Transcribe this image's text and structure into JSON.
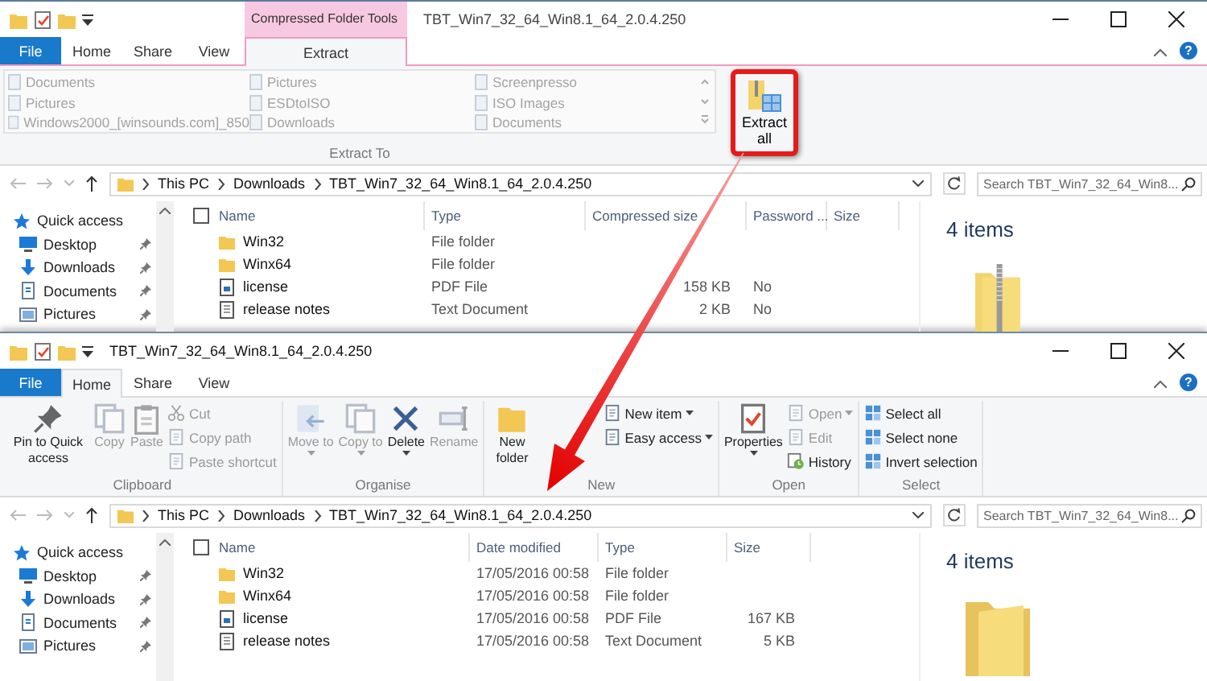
{
  "windows": [
    {
      "title": "TBT_Win7_32_64_Win8.1_64_2.0.4.250",
      "context_tab": "Compressed Folder Tools",
      "help": "?",
      "tabs": [
        {
          "label": "File",
          "kind": "file",
          "selected": false
        },
        {
          "label": "Home",
          "kind": "tab",
          "selected": false
        },
        {
          "label": "Share",
          "kind": "tab",
          "selected": false
        },
        {
          "label": "View",
          "kind": "tab",
          "selected": false
        },
        {
          "label": "Extract",
          "kind": "context",
          "selected": true
        }
      ],
      "ribbon": {
        "kind": "extract",
        "group_label": "Extract To",
        "button": "Extract all",
        "highlighted": true,
        "locations": [
          "Documents",
          "Pictures",
          "Screenpresso",
          "Pictures",
          "ESDtoISO",
          "ISO Images",
          "Windows2000_[winsounds.com]_850",
          "Downloads",
          "Documents"
        ]
      },
      "breadcrumb": [
        "This PC",
        "Downloads",
        "TBT_Win7_32_64_Win8.1_64_2.0.4.250"
      ],
      "search_placeholder": "Search TBT_Win7_32_64_Win8...",
      "nav": [
        {
          "label": "Quick access",
          "kind": "header",
          "pinned": false
        },
        {
          "label": "Desktop",
          "kind": "desktop",
          "pinned": true
        },
        {
          "label": "Downloads",
          "kind": "downloads",
          "pinned": true
        },
        {
          "label": "Documents",
          "kind": "documents",
          "pinned": true
        },
        {
          "label": "Pictures",
          "kind": "pictures",
          "pinned": true
        }
      ],
      "select_all_checked": false,
      "columns": [
        "Name",
        "Type",
        "Compressed size",
        "Password ...",
        "Size"
      ],
      "rows": [
        {
          "kind": "folder",
          "cells": [
            "Win32",
            "File folder",
            null,
            null,
            null
          ]
        },
        {
          "kind": "folder",
          "cells": [
            "Winx64",
            "File folder",
            null,
            null,
            null
          ]
        },
        {
          "kind": "pdf",
          "cells": [
            "license",
            "PDF File",
            "158 KB",
            "No",
            null
          ]
        },
        {
          "kind": "text",
          "cells": [
            "release notes",
            "Text Document",
            "2 KB",
            "No",
            null
          ]
        }
      ],
      "details": "4 items"
    },
    {
      "title": "TBT_Win7_32_64_Win8.1_64_2.0.4.250",
      "help": "?",
      "tabs": [
        {
          "label": "File",
          "kind": "file",
          "selected": false
        },
        {
          "label": "Home",
          "kind": "tab",
          "selected": true
        },
        {
          "label": "Share",
          "kind": "tab",
          "selected": false
        },
        {
          "label": "View",
          "kind": "tab",
          "selected": false
        }
      ],
      "ribbon": {
        "kind": "groups",
        "groups": [
          {
            "label": "Clipboard",
            "items": [
              {
                "label": "Pin to Quick access",
                "kind": "large",
                "disabled": false,
                "dropdown": false
              },
              {
                "label": "Copy",
                "kind": "large",
                "disabled": true,
                "dropdown": false
              },
              {
                "label": "Paste",
                "kind": "large",
                "disabled": true,
                "dropdown": false
              },
              {
                "label": "Cut",
                "kind": "small",
                "disabled": true,
                "dropdown": false
              },
              {
                "label": "Copy path",
                "kind": "small",
                "disabled": true,
                "dropdown": false
              },
              {
                "label": "Paste shortcut",
                "kind": "small",
                "disabled": true,
                "dropdown": false
              }
            ]
          },
          {
            "label": "Organise",
            "items": [
              {
                "label": "Move to",
                "kind": "large",
                "disabled": true,
                "dropdown": true
              },
              {
                "label": "Copy to",
                "kind": "large",
                "disabled": true,
                "dropdown": true
              },
              {
                "label": "Delete",
                "kind": "large",
                "disabled": false,
                "dropdown": true
              },
              {
                "label": "Rename",
                "kind": "large",
                "disabled": true,
                "dropdown": false
              }
            ]
          },
          {
            "label": "New",
            "items": [
              {
                "label": "New folder",
                "kind": "large",
                "disabled": false,
                "dropdown": false
              },
              {
                "label": "New item",
                "kind": "small",
                "disabled": false,
                "dropdown": true
              },
              {
                "label": "Easy access",
                "kind": "small",
                "disabled": false,
                "dropdown": true
              }
            ]
          },
          {
            "label": "Open",
            "items": [
              {
                "label": "Properties",
                "kind": "large",
                "disabled": false,
                "dropdown": true
              },
              {
                "label": "Open",
                "kind": "small",
                "disabled": true,
                "dropdown": true
              },
              {
                "label": "Edit",
                "kind": "small",
                "disabled": true,
                "dropdown": false
              },
              {
                "label": "History",
                "kind": "small",
                "disabled": false,
                "dropdown": false
              }
            ]
          },
          {
            "label": "Select",
            "items": [
              {
                "label": "Select all",
                "kind": "small",
                "disabled": false,
                "dropdown": false
              },
              {
                "label": "Select none",
                "kind": "small",
                "disabled": false,
                "dropdown": false
              },
              {
                "label": "Invert selection",
                "kind": "small",
                "disabled": false,
                "dropdown": false
              }
            ]
          }
        ]
      },
      "breadcrumb": [
        "This PC",
        "Downloads",
        "TBT_Win7_32_64_Win8.1_64_2.0.4.250"
      ],
      "search_placeholder": "Search TBT_Win7_32_64_Win8...",
      "nav": [
        {
          "label": "Quick access",
          "kind": "header",
          "pinned": false
        },
        {
          "label": "Desktop",
          "kind": "desktop",
          "pinned": true
        },
        {
          "label": "Downloads",
          "kind": "downloads",
          "pinned": true
        },
        {
          "label": "Documents",
          "kind": "documents",
          "pinned": true
        },
        {
          "label": "Pictures",
          "kind": "pictures",
          "pinned": true
        }
      ],
      "select_all_checked": false,
      "columns": [
        "Name",
        "Date modified",
        "Type",
        "Size"
      ],
      "rows": [
        {
          "kind": "folder",
          "cells": [
            "Win32",
            "17/05/2016 00:58",
            "File folder",
            null
          ]
        },
        {
          "kind": "folder",
          "cells": [
            "Winx64",
            "17/05/2016 00:58",
            "File folder",
            null
          ]
        },
        {
          "kind": "pdf",
          "cells": [
            "license",
            "17/05/2016 00:58",
            "PDF File",
            "167 KB"
          ]
        },
        {
          "kind": "text",
          "cells": [
            "release notes",
            "17/05/2016 00:58",
            "Text Document",
            "5 KB"
          ]
        }
      ],
      "details": "4 items"
    }
  ]
}
